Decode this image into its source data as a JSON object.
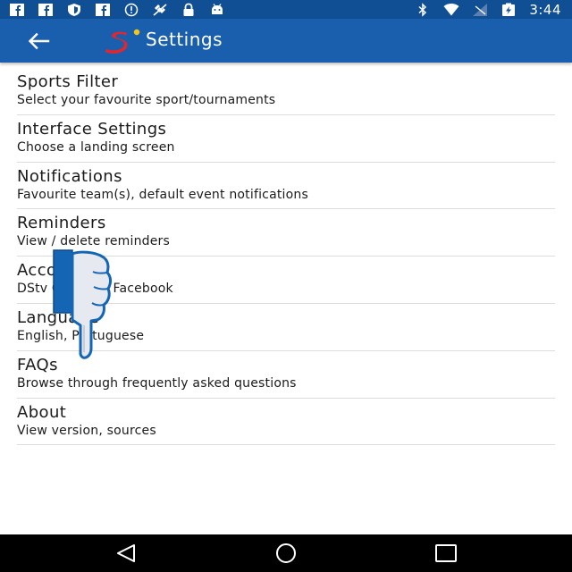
{
  "status_bar": {
    "time": "3:44",
    "left_icons": [
      "facebook-icon",
      "facebook-icon",
      "shield-icon",
      "facebook-icon",
      "warning-icon",
      "no-satellite-icon",
      "lock-icon",
      "android-icon"
    ],
    "right_icons": [
      "bluetooth-icon",
      "wifi-icon",
      "signal-icon",
      "battery-charging-icon"
    ]
  },
  "app_bar": {
    "title": "Settings",
    "back_icon": "arrow-left-icon",
    "logo": "supersport-logo",
    "background": "#1a5fad"
  },
  "settings": [
    {
      "title": "Sports Filter",
      "subtitle": "Select your favourite sport/tournaments"
    },
    {
      "title": "Interface Settings",
      "subtitle": "Choose a landing screen"
    },
    {
      "title": "Notifications",
      "subtitle": "Favourite team(s), default event notifications"
    },
    {
      "title": "Reminders",
      "subtitle": "View / delete reminders"
    },
    {
      "title": "Accounts",
      "subtitle": "DStv Connect, Facebook"
    },
    {
      "title": "Language",
      "subtitle": "English, Portuguese"
    },
    {
      "title": "FAQs",
      "subtitle": "Browse through frequently asked questions"
    },
    {
      "title": "About",
      "subtitle": "View version, sources"
    }
  ],
  "nav_bar": {
    "buttons": [
      "back-triangle-icon",
      "home-circle-icon",
      "recents-square-icon"
    ]
  },
  "colors": {
    "status_bar": "#114f94",
    "app_bar": "#1a5fad",
    "logo_red": "#e3262d",
    "logo_yellow": "#f5c518",
    "divider": "#dcdcdc"
  }
}
